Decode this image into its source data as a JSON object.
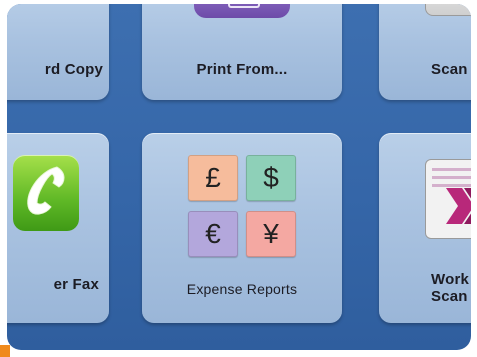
{
  "tiles": {
    "card_copy": "rd Copy",
    "print_from": "Print From...",
    "scan": "Scan",
    "fax": "er Fax",
    "expense_reports": "Expense Reports",
    "workflow_line1": "Work",
    "workflow_line2": "Scan"
  },
  "currency": {
    "pound": "£",
    "dollar": "$",
    "euro": "€",
    "yen": "¥"
  },
  "icons": {
    "print": "print-icon",
    "scan": "scanner-icon",
    "fax": "phone-icon",
    "expense": "currency-icon",
    "workflow": "workflow-document-icon"
  },
  "colors": {
    "screen_background": "#3566a8",
    "tile": "#a9c2e0",
    "fax_green": "#5fb826",
    "print_purple": "#6d4ba8"
  }
}
